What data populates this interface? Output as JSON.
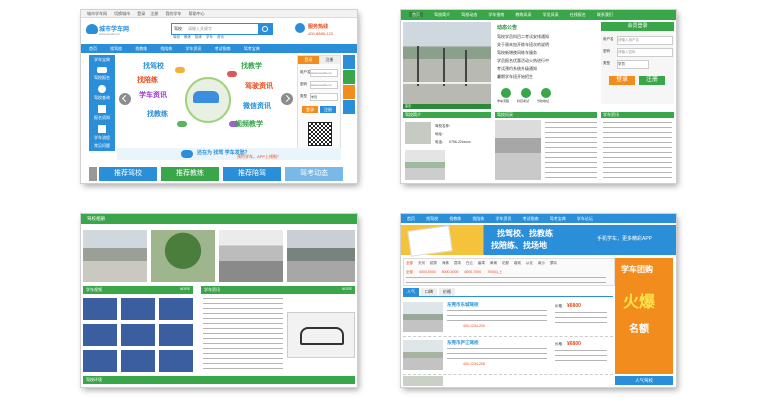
{
  "shot1": {
    "topbar": [
      "城市学车网",
      "切换城市",
      "登录",
      "注册",
      "我的学车",
      "帮助中心"
    ],
    "logo_text": "城市学车网",
    "logo_sub": "www.xueche.cn",
    "search_select": "驾校",
    "search_placeholder": "请输入关键字",
    "search_tags": [
      "驾校",
      "教练",
      "陪练",
      "学车",
      "资讯"
    ],
    "hotline_label": "服务热线",
    "hotline": "400-8888-123",
    "nav": [
      "首页",
      "找驾校",
      "找教练",
      "找陪练",
      "学车资讯",
      "考试指南",
      "驾考宝典"
    ],
    "left_menu": [
      "学车宝典",
      "驾校报名",
      "驾校查询",
      "报名须知",
      "学车流程",
      "常见问题"
    ],
    "banner_labels": [
      "找驾校",
      "找陪练",
      "学车资讯",
      "找教练",
      "找教学",
      "驾驶资讯",
      "微信资讯",
      "视频教学"
    ],
    "tabs": [
      "登录",
      "注册"
    ],
    "login_user_label": "用户名",
    "login_user": "www.xueche.cn",
    "login_pass_label": "密码",
    "login_pass": "www.xueche.cn",
    "login_type_label": "类型",
    "login_type": "学员",
    "login_btn": "登录",
    "register_btn": "注册",
    "ribbon_text": "还在为 找驾 学车发愁？",
    "ribbon_sub": "预约学车，APP上线啦！",
    "bottom_buttons": [
      "推荐驾校",
      "推荐教练",
      "推荐陪驾",
      "驾考动态"
    ]
  },
  "shot2": {
    "nav": [
      "首页",
      "驾校简介",
      "驾校动态",
      "学车指南",
      "教练风采",
      "学员风采",
      "在线报名",
      "联系我们"
    ],
    "notice_title": "动态公告",
    "notices": [
      "驾校学员科目二考试安排通知",
      "关于周末加开练车班次的说明",
      "驾校新增夜间练车服务",
      "学员报名优惠活动火热进行中",
      "考试预约系统升级通知",
      "暑期学车班开始招生"
    ],
    "login_title": "会员登录",
    "login_labels": [
      "用户名",
      "密码",
      "类型"
    ],
    "login_placeholders": [
      "请输入用户名",
      "请输入密码"
    ],
    "login_type": "学员",
    "login_btn": "登录",
    "register_btn": "注册",
    "icon_labels": [
      "学车流程",
      "科目考试",
      "驾校地址"
    ],
    "panel_titles": [
      "驾校简介",
      "驾校风采",
      "学车资讯"
    ],
    "intro": [
      "驾校名称：",
      "地址：",
      "电话："
    ],
    "intro_phone": "0756-22xxxxx"
  },
  "shot3": {
    "title": "驾校相册",
    "section_titles": [
      "学车视频",
      "学车资讯",
      "驾校环境"
    ],
    "more": "MORE"
  },
  "shot4": {
    "nav": [
      "首页",
      "找驾校",
      "找教练",
      "找陪练",
      "学车资讯",
      "考试指南",
      "驾考宝典",
      "学车论坛"
    ],
    "banner_line1": "找驾校、找教练",
    "banner_line2": "找陪练、找场地",
    "banner_right": "手机学车，更多精彩APP",
    "filter_tags": [
      "全部",
      "天河",
      "越秀",
      "海珠",
      "荔湾",
      "白云",
      "番禺",
      "黄埔",
      "花都",
      "增城",
      "从化",
      "南沙",
      "萝岗"
    ],
    "price_tags": [
      "全部",
      "4000-5000",
      "5000-6000",
      "6000-7000",
      "7000以上"
    ],
    "sort_tabs": [
      "人气",
      "口碑",
      "价格"
    ],
    "schools": [
      {
        "name": "东莞市东城驾校",
        "price": "¥6800",
        "phone": "400-1234-200"
      },
      {
        "name": "东莞市庐江驾校",
        "price": "¥6800",
        "phone": "400-1234-208"
      }
    ],
    "price_label": "价格",
    "detail_btn": "查看详情",
    "ad_title": "学车团购",
    "ad_big": "火爆",
    "ad_foot": "名额",
    "hot_title": "人气驾校"
  }
}
